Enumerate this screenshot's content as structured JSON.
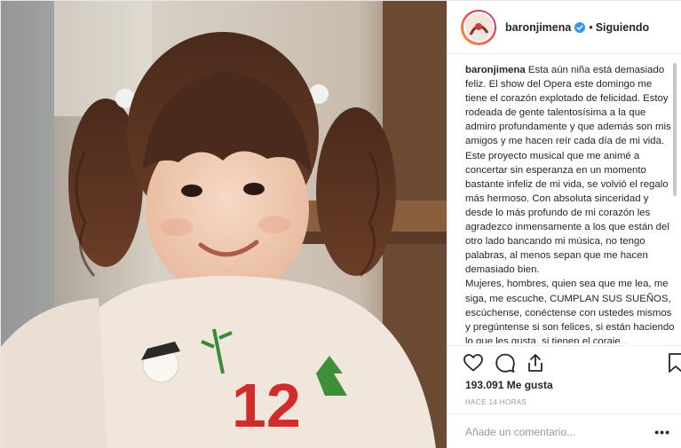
{
  "post": {
    "username": "baronjimena",
    "verified": true,
    "follow_state": "Siguiendo",
    "dot": "•",
    "caption": {
      "user": "baronjimena",
      "paragraphs": [
        "Esta aún niña está demasiado feliz. El show del Opera este domingo me tiene el corazón explotado de felicidad. Estoy rodeada de gente talentosísima a la que admiro profundamente y que además son mis amigos y me hacen reír cada día de mi vida. Este proyecto musical que me animé a concertar sin esperanza en un momento bastante infeliz de mi vida, se volvió el regalo más hermoso. Con absoluta sinceridad y desde lo más profundo de mi corazón les agradezco inmensamente a los que están del otro lado bancando mi música, no tengo palabras, al menos sepan que me hacen demasiado bien.",
        "Mujeres, hombres, quien sea que me lea, me siga, me escuche, CUMPLAN SUS SUEÑOS, escúchense, conéctense con ustedes mismos y pregúntense si son felices, si están haciendo lo que les gusta, si tienen el coraje..."
      ]
    },
    "likes": "193.091 Me gusta",
    "time_ago": "HACE 14 HORAS",
    "comment_placeholder": "Añade un comentario...",
    "more_label": "•••"
  },
  "icons": {
    "like": "heart-icon",
    "comment": "comment-bubble-icon",
    "share": "share-icon",
    "save": "bookmark-icon",
    "verified": "verified-badge-icon"
  },
  "colors": {
    "verified_blue": "#3897f0",
    "text": "#262626",
    "muted": "#999999",
    "border": "#efefef"
  }
}
